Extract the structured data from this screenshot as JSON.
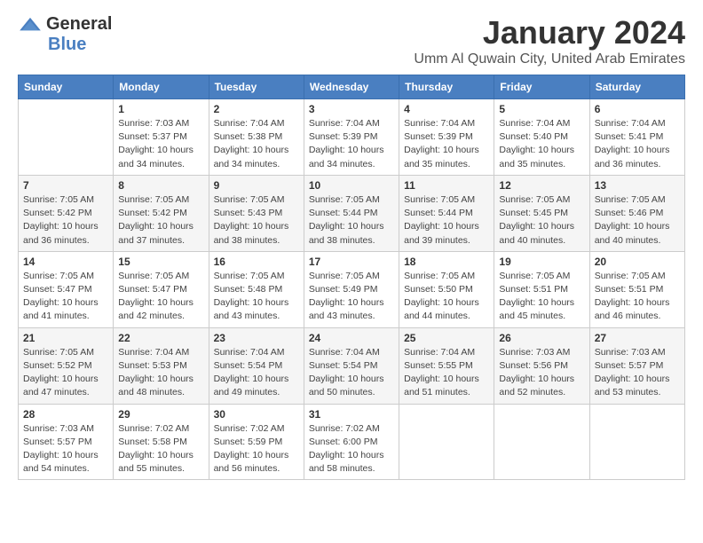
{
  "logo": {
    "general": "General",
    "blue": "Blue"
  },
  "title": "January 2024",
  "subtitle": "Umm Al Quwain City, United Arab Emirates",
  "days_header": [
    "Sunday",
    "Monday",
    "Tuesday",
    "Wednesday",
    "Thursday",
    "Friday",
    "Saturday"
  ],
  "weeks": [
    [
      {
        "day": "",
        "info": ""
      },
      {
        "day": "1",
        "info": "Sunrise: 7:03 AM\nSunset: 5:37 PM\nDaylight: 10 hours\nand 34 minutes."
      },
      {
        "day": "2",
        "info": "Sunrise: 7:04 AM\nSunset: 5:38 PM\nDaylight: 10 hours\nand 34 minutes."
      },
      {
        "day": "3",
        "info": "Sunrise: 7:04 AM\nSunset: 5:39 PM\nDaylight: 10 hours\nand 34 minutes."
      },
      {
        "day": "4",
        "info": "Sunrise: 7:04 AM\nSunset: 5:39 PM\nDaylight: 10 hours\nand 35 minutes."
      },
      {
        "day": "5",
        "info": "Sunrise: 7:04 AM\nSunset: 5:40 PM\nDaylight: 10 hours\nand 35 minutes."
      },
      {
        "day": "6",
        "info": "Sunrise: 7:04 AM\nSunset: 5:41 PM\nDaylight: 10 hours\nand 36 minutes."
      }
    ],
    [
      {
        "day": "7",
        "info": "Sunrise: 7:05 AM\nSunset: 5:42 PM\nDaylight: 10 hours\nand 36 minutes."
      },
      {
        "day": "8",
        "info": "Sunrise: 7:05 AM\nSunset: 5:42 PM\nDaylight: 10 hours\nand 37 minutes."
      },
      {
        "day": "9",
        "info": "Sunrise: 7:05 AM\nSunset: 5:43 PM\nDaylight: 10 hours\nand 38 minutes."
      },
      {
        "day": "10",
        "info": "Sunrise: 7:05 AM\nSunset: 5:44 PM\nDaylight: 10 hours\nand 38 minutes."
      },
      {
        "day": "11",
        "info": "Sunrise: 7:05 AM\nSunset: 5:44 PM\nDaylight: 10 hours\nand 39 minutes."
      },
      {
        "day": "12",
        "info": "Sunrise: 7:05 AM\nSunset: 5:45 PM\nDaylight: 10 hours\nand 40 minutes."
      },
      {
        "day": "13",
        "info": "Sunrise: 7:05 AM\nSunset: 5:46 PM\nDaylight: 10 hours\nand 40 minutes."
      }
    ],
    [
      {
        "day": "14",
        "info": "Sunrise: 7:05 AM\nSunset: 5:47 PM\nDaylight: 10 hours\nand 41 minutes."
      },
      {
        "day": "15",
        "info": "Sunrise: 7:05 AM\nSunset: 5:47 PM\nDaylight: 10 hours\nand 42 minutes."
      },
      {
        "day": "16",
        "info": "Sunrise: 7:05 AM\nSunset: 5:48 PM\nDaylight: 10 hours\nand 43 minutes."
      },
      {
        "day": "17",
        "info": "Sunrise: 7:05 AM\nSunset: 5:49 PM\nDaylight: 10 hours\nand 43 minutes."
      },
      {
        "day": "18",
        "info": "Sunrise: 7:05 AM\nSunset: 5:50 PM\nDaylight: 10 hours\nand 44 minutes."
      },
      {
        "day": "19",
        "info": "Sunrise: 7:05 AM\nSunset: 5:51 PM\nDaylight: 10 hours\nand 45 minutes."
      },
      {
        "day": "20",
        "info": "Sunrise: 7:05 AM\nSunset: 5:51 PM\nDaylight: 10 hours\nand 46 minutes."
      }
    ],
    [
      {
        "day": "21",
        "info": "Sunrise: 7:05 AM\nSunset: 5:52 PM\nDaylight: 10 hours\nand 47 minutes."
      },
      {
        "day": "22",
        "info": "Sunrise: 7:04 AM\nSunset: 5:53 PM\nDaylight: 10 hours\nand 48 minutes."
      },
      {
        "day": "23",
        "info": "Sunrise: 7:04 AM\nSunset: 5:54 PM\nDaylight: 10 hours\nand 49 minutes."
      },
      {
        "day": "24",
        "info": "Sunrise: 7:04 AM\nSunset: 5:54 PM\nDaylight: 10 hours\nand 50 minutes."
      },
      {
        "day": "25",
        "info": "Sunrise: 7:04 AM\nSunset: 5:55 PM\nDaylight: 10 hours\nand 51 minutes."
      },
      {
        "day": "26",
        "info": "Sunrise: 7:03 AM\nSunset: 5:56 PM\nDaylight: 10 hours\nand 52 minutes."
      },
      {
        "day": "27",
        "info": "Sunrise: 7:03 AM\nSunset: 5:57 PM\nDaylight: 10 hours\nand 53 minutes."
      }
    ],
    [
      {
        "day": "28",
        "info": "Sunrise: 7:03 AM\nSunset: 5:57 PM\nDaylight: 10 hours\nand 54 minutes."
      },
      {
        "day": "29",
        "info": "Sunrise: 7:02 AM\nSunset: 5:58 PM\nDaylight: 10 hours\nand 55 minutes."
      },
      {
        "day": "30",
        "info": "Sunrise: 7:02 AM\nSunset: 5:59 PM\nDaylight: 10 hours\nand 56 minutes."
      },
      {
        "day": "31",
        "info": "Sunrise: 7:02 AM\nSunset: 6:00 PM\nDaylight: 10 hours\nand 58 minutes."
      },
      {
        "day": "",
        "info": ""
      },
      {
        "day": "",
        "info": ""
      },
      {
        "day": "",
        "info": ""
      }
    ]
  ]
}
